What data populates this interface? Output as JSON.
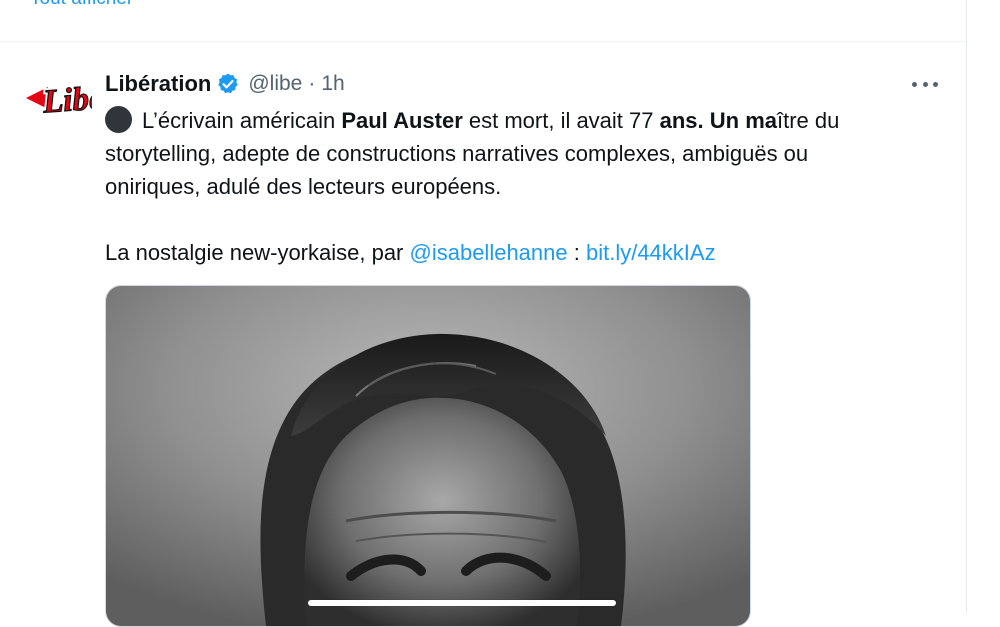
{
  "thread": {
    "show_more_label": "Tout afficher"
  },
  "tweet": {
    "author_name": "Libération",
    "author_handle": "@libe",
    "separator": "·",
    "time": "1h",
    "avatar_logo_text": "Libé",
    "verified_icon": "verified-badge-icon",
    "more_icon": "more-options-icon",
    "text": {
      "line1_emoji": "black-circle-emoji",
      "line1_a": "L’écrivain américain ",
      "line1_bold1": "Paul Auster",
      "line1_b": " est mort, il avait 77 ",
      "line1_bold2": "ans. Un ma",
      "line1_c": "ître du",
      "line2": "storytelling, adepte de constructions narratives complexes, ambiguës ou",
      "line3": "oniriques, adulé des lecteurs européens.",
      "line5_a": "La nostalgie new-yorkaise, par ",
      "mention": "@isabellehanne",
      "line5_b": " : ",
      "url": "bit.ly/44kkIAz"
    },
    "media": {
      "description": "photo-portrait"
    }
  },
  "colors": {
    "accent": "#1d9bf0",
    "text_primary": "#0f1419",
    "text_secondary": "#536471",
    "logo_red": "#e30613"
  }
}
